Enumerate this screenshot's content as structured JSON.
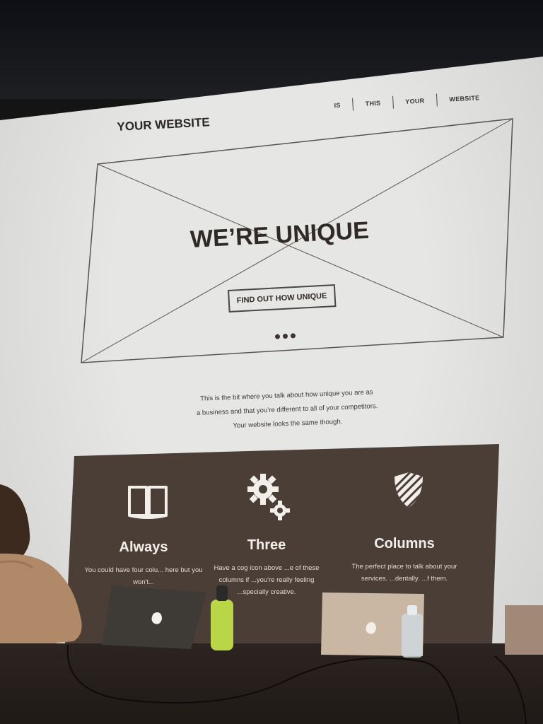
{
  "site": {
    "brand": "YOUR WEBSITE",
    "nav": [
      "IS",
      "THIS",
      "YOUR",
      "WEBSITE"
    ]
  },
  "hero": {
    "headline": "WE’RE UNIQUE",
    "cta_label": "FIND OUT HOW UNIQUE",
    "slide_count": 3
  },
  "intro": {
    "lines": [
      "This is the bit where you talk about how unique you are as",
      "a business and that you’re different to all of your competitors.",
      "Your website looks the same though."
    ]
  },
  "features": [
    {
      "icon": "book-icon",
      "title": "Always",
      "body": "You could have four colu... here but you won't..."
    },
    {
      "icon": "cog-icon",
      "title": "Three",
      "body": "Have a cog icon above ...e of these columns if ...you're really feeling ...specially creative."
    },
    {
      "icon": "shield-icon",
      "title": "Columns",
      "body": "The perfect place to talk about your services. ...dentally. ...f them."
    }
  ],
  "colors": {
    "screen": "#e6e6e4",
    "feature_panel": "#4b3e37",
    "ink": "#2f2a26",
    "bottle": "#b8d645"
  }
}
